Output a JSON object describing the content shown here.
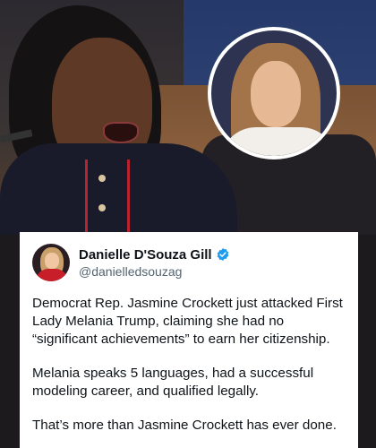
{
  "tweet": {
    "author_name": "Danielle D'Souza Gill",
    "author_handle": "@danielledsouzag",
    "verified": true,
    "paragraphs": [
      "Democrat Rep. Jasmine Crockett just attacked First Lady Melania Trump, claiming she had no “significant achievements” to earn her citizenship.",
      "Melania speaks 5 languages, had a successful modeling career, and qualified legally.",
      "That’s more than Jasmine Crockett has ever done."
    ]
  },
  "colors": {
    "card_bg": "#ffffff",
    "text": "#0f1419",
    "handle": "#536471",
    "verified_badge": "#1d9bf0",
    "jacket_trim": "#b8232f"
  },
  "icons": {
    "verified": "verified-badge-icon"
  }
}
